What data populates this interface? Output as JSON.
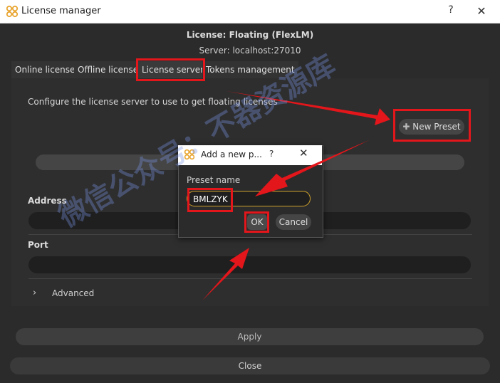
{
  "window": {
    "title": "License manager",
    "help": "?",
    "close": "✕"
  },
  "header": {
    "license": "License: Floating (FlexLM)",
    "server": "Server: localhost:27010"
  },
  "tabs": [
    {
      "label": "Online license"
    },
    {
      "label": "Offline license"
    },
    {
      "label": "License server"
    },
    {
      "label": "Tokens management"
    }
  ],
  "main": {
    "configure_text": "Configure the license server to use to get floating licenses",
    "new_preset_label": "New Preset",
    "plus": "✚",
    "address_label": "Address",
    "port_label": "Port",
    "advanced_label": "Advanced",
    "chevron": "›",
    "apply_label": "Apply",
    "close_label": "Close"
  },
  "dialog": {
    "title": "Add a new p...",
    "help": "?",
    "close": "✕",
    "preset_name_label": "Preset name",
    "preset_value": "BMLZYK",
    "ok_label": "OK",
    "cancel_label": "Cancel"
  },
  "watermark": "微信公众号：不器资源库",
  "colors": {
    "highlight": "#e3161b",
    "accent": "#d0a22c",
    "logo": "#e8a531"
  }
}
